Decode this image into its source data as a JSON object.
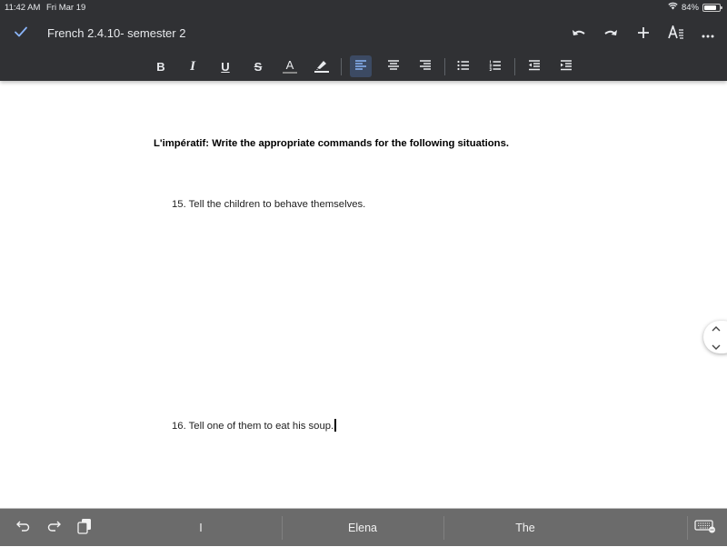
{
  "status_bar": {
    "time": "11:42 AM",
    "date": "Fri Mar 19",
    "battery_percent_label": "84%",
    "battery_level": 0.84,
    "icons": [
      "wifi-icon",
      "battery-icon"
    ]
  },
  "header": {
    "doc_title": "French 2.4.10- semester 2",
    "done_icon": "check-icon",
    "actions": [
      {
        "name": "undo",
        "icon": "undo-icon"
      },
      {
        "name": "redo",
        "icon": "redo-icon"
      },
      {
        "name": "insert",
        "icon": "plus-icon"
      },
      {
        "name": "format",
        "icon": "text-format-icon"
      },
      {
        "name": "more",
        "icon": "more-icon"
      }
    ]
  },
  "format_toolbar": {
    "bold": "B",
    "italic": "I",
    "underline": "U",
    "strikethrough": "S",
    "text_color": "A",
    "highlight": "highlight-icon",
    "align_left_active": true,
    "accent_color": "#8ab4f8"
  },
  "document": {
    "heading": "L'impératif: Write the appropriate commands for the following situations.",
    "questions": [
      {
        "text": "15. Tell the children to behave themselves."
      },
      {
        "text": "16. Tell one of them to eat his soup."
      }
    ]
  },
  "keyboard_bar": {
    "suggestions": [
      "I",
      "Elena",
      "The"
    ],
    "icons": [
      "undo-icon",
      "redo-icon",
      "paste-icon",
      "keyboard-icon"
    ]
  }
}
